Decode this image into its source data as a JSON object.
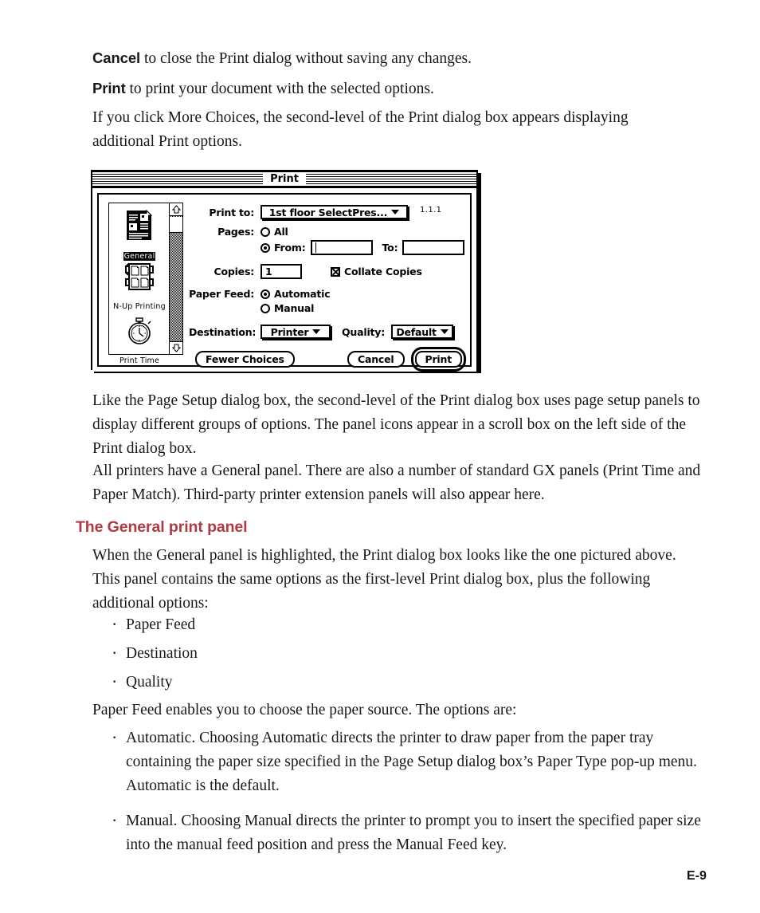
{
  "document": {
    "page_number": "E-9",
    "heading_color": "#b03a43",
    "paragraphs": {
      "cancel_lead": "Cancel",
      "cancel_rest": " to close the Print dialog without saving any changes.",
      "print_lead": "Print",
      "print_rest": " to print your document with the selected options.",
      "more_choices": "If you click More Choices, the second-level of the Print dialog box appears displaying additional Print options.",
      "page_setup_panels": "Like the Page Setup dialog box, the second-level of the Print dialog box uses page setup panels to display different groups of options. The panel icons appear in a scroll box on the left side of the Print dialog box.",
      "gx_panels": "All printers have a General panel. There are also a number of standard GX panels (Print Time and Paper Match). Third-party printer extension panels will also appear here.",
      "general_panel_intro": "When the General panel is highlighted, the Print dialog box looks like the one pictured above. This panel contains the same options as the first-level Print dialog box, plus the following additional options:",
      "paper_feed_intro": "Paper Feed enables you to choose the paper source. The options are:"
    },
    "section_heading": "The General print panel",
    "options_list": [
      "Paper Feed",
      "Destination",
      "Quality"
    ],
    "paper_feed_list": [
      "Automatic.  Choosing Automatic directs the printer to draw paper from the paper tray containing the paper size specified in the Page Setup dialog box’s Paper Type pop-up menu. Automatic is the default.",
      "Manual.  Choosing Manual directs the printer to prompt you to insert the specified paper size into the manual feed position and press the Manual Feed key."
    ]
  },
  "dialog": {
    "title": "Print",
    "version": "1.1.1",
    "panels": [
      {
        "label": "General",
        "icon": "document-icon",
        "selected": true
      },
      {
        "label": "N-Up Printing",
        "icon": "n-up-pages-icon",
        "selected": false
      },
      {
        "label": "Print Time",
        "icon": "stopwatch-icon",
        "selected": false
      }
    ],
    "scrollbar": {
      "up_arrow": "scroll-up-arrow-icon",
      "down_arrow": "scroll-down-arrow-icon"
    },
    "fields": {
      "print_to_label": "Print to:",
      "print_to_value": "1st floor SelectPres...",
      "pages_label": "Pages:",
      "pages_all_label": "All",
      "pages_all_selected": false,
      "pages_from_label": "From:",
      "pages_from_selected": true,
      "pages_from_value": "",
      "pages_to_label": "To:",
      "pages_to_value": "",
      "copies_label": "Copies:",
      "copies_value": "1",
      "collate_label": "Collate Copies",
      "collate_checked": true,
      "paper_feed_label": "Paper Feed:",
      "paper_feed_automatic_label": "Automatic",
      "paper_feed_automatic_selected": true,
      "paper_feed_manual_label": "Manual",
      "paper_feed_manual_selected": false,
      "destination_label": "Destination:",
      "destination_value": "Printer",
      "quality_label": "Quality:",
      "quality_value": "Default"
    },
    "buttons": {
      "fewer_choices": "Fewer Choices",
      "cancel": "Cancel",
      "print": "Print"
    }
  }
}
